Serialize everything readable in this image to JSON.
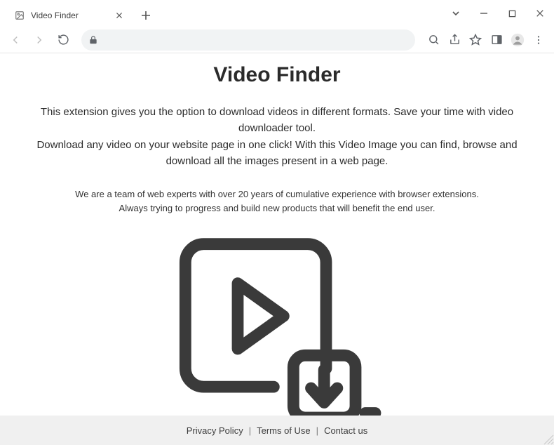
{
  "browser": {
    "tab_title": "Video Finder",
    "window_controls": {
      "dropdown": "⌄",
      "minimize": "—",
      "maximize": "▢",
      "close": "✕"
    }
  },
  "page": {
    "title": "Video Finder",
    "desc_line1": "This extension gives you the option to download videos in different formats. Save your time with video downloader tool.",
    "desc_line2": "Download any video on your website page in one click! With this Video Image you can find, browse and download all the images present in a web page.",
    "sub_line1": "We are a team of web experts with over 20 years of cumulative experience with browser extensions.",
    "sub_line2": "Always trying to progress and build new products that will benefit the end user."
  },
  "footer": {
    "privacy": "Privacy Policy",
    "terms": "Terms of Use",
    "contact": "Contact us",
    "sep": "|"
  },
  "colors": {
    "icon_stroke": "#3a3a3a"
  }
}
